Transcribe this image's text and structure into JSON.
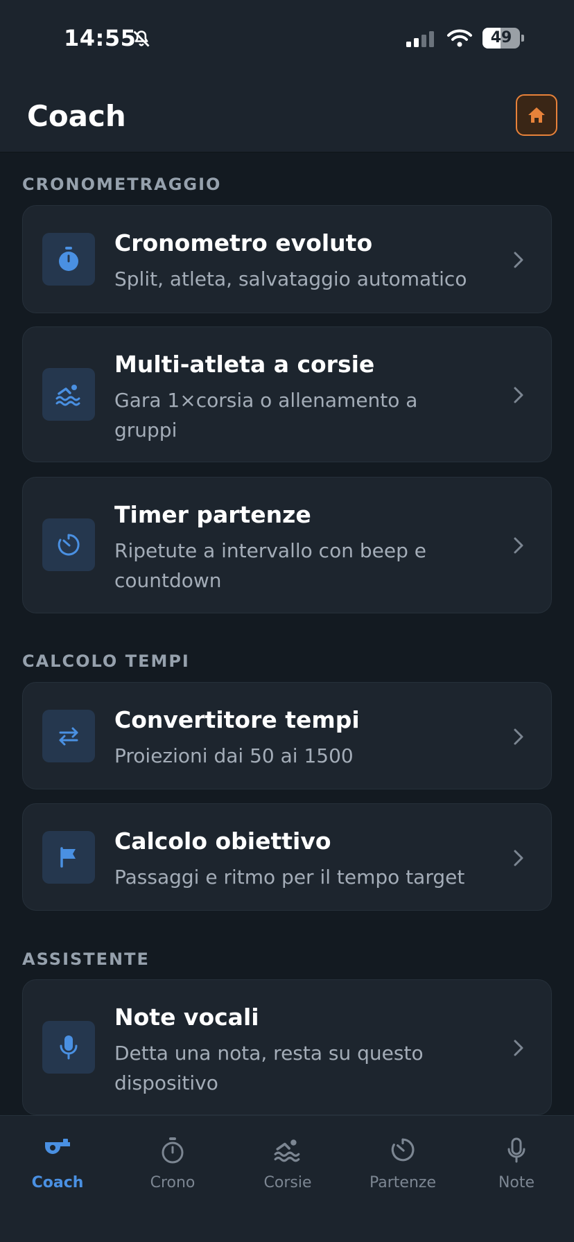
{
  "status_bar": {
    "time": "14:55",
    "battery": "49",
    "battery_level": 0.49
  },
  "header": {
    "title": "Coach",
    "home_icon": "home-icon"
  },
  "colors": {
    "accent": "#4a90e2",
    "home_accent": "#e8823a",
    "background": "#131a21",
    "card": "#1d252e"
  },
  "sections": [
    {
      "title": "CRONOMETRAGGIO",
      "items": [
        {
          "title": "Cronometro evoluto",
          "subtitle": "Split, atleta, salvataggio automatico",
          "icon": "stopwatch-icon"
        },
        {
          "title": "Multi-atleta a corsie",
          "subtitle": "Gara 1×corsia o allenamento a gruppi",
          "icon": "swimmer-icon"
        },
        {
          "title": "Timer partenze",
          "subtitle": "Ripetute a intervallo con beep e countdown",
          "icon": "timer-icon"
        }
      ]
    },
    {
      "title": "CALCOLO TEMPI",
      "items": [
        {
          "title": "Convertitore tempi",
          "subtitle": "Proiezioni dai 50 ai 1500",
          "icon": "swap-arrows-icon"
        },
        {
          "title": "Calcolo obiettivo",
          "subtitle": "Passaggi e ritmo per il tempo target",
          "icon": "flag-icon"
        }
      ]
    },
    {
      "title": "ASSISTENTE",
      "items": [
        {
          "title": "Note vocali",
          "subtitle": "Detta una nota, resta su questo dispositivo",
          "icon": "microphone-icon"
        }
      ]
    }
  ],
  "tabs": [
    {
      "label": "Coach",
      "icon": "whistle-icon",
      "active": true
    },
    {
      "label": "Crono",
      "icon": "stopwatch-icon",
      "active": false
    },
    {
      "label": "Corsie",
      "icon": "swimmer-icon",
      "active": false
    },
    {
      "label": "Partenze",
      "icon": "timer-icon",
      "active": false
    },
    {
      "label": "Note",
      "icon": "microphone-icon",
      "active": false
    }
  ]
}
